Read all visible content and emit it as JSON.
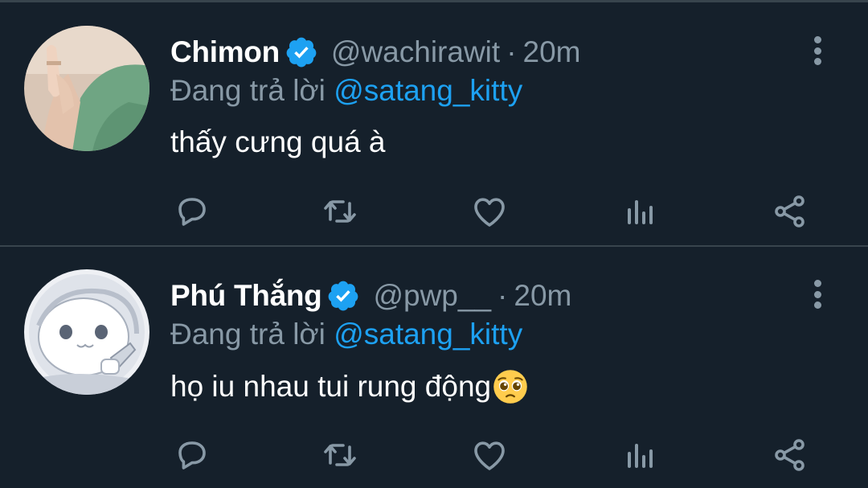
{
  "tweets": [
    {
      "name": "Chimon",
      "handle": "@wachirawit",
      "separator": "·",
      "time": "20m",
      "reply_prefix": "Đang trả lời",
      "reply_to": "@satang_kitty",
      "text": "thấy cưng quá à",
      "emoji": ""
    },
    {
      "name": "Phú Thắng",
      "handle": "@pwp__",
      "separator": "·",
      "time": "20m",
      "reply_prefix": "Đang trả lời",
      "reply_to": "@satang_kitty",
      "text": "họ iu nhau tui rung động",
      "emoji": "pleading-face"
    }
  ],
  "icons": {
    "reply": "comment-bubble-icon",
    "retweet": "retweet-icon",
    "like": "heart-icon",
    "stats": "analytics-icon",
    "share": "share-icon",
    "verified": "verified-badge-icon",
    "more": "vertical-dots-icon"
  },
  "colors": {
    "background": "#15202b",
    "divider": "#38444d",
    "secondary_text": "#8899a6",
    "accent": "#1da1f2",
    "verified": "#1da1f2"
  }
}
